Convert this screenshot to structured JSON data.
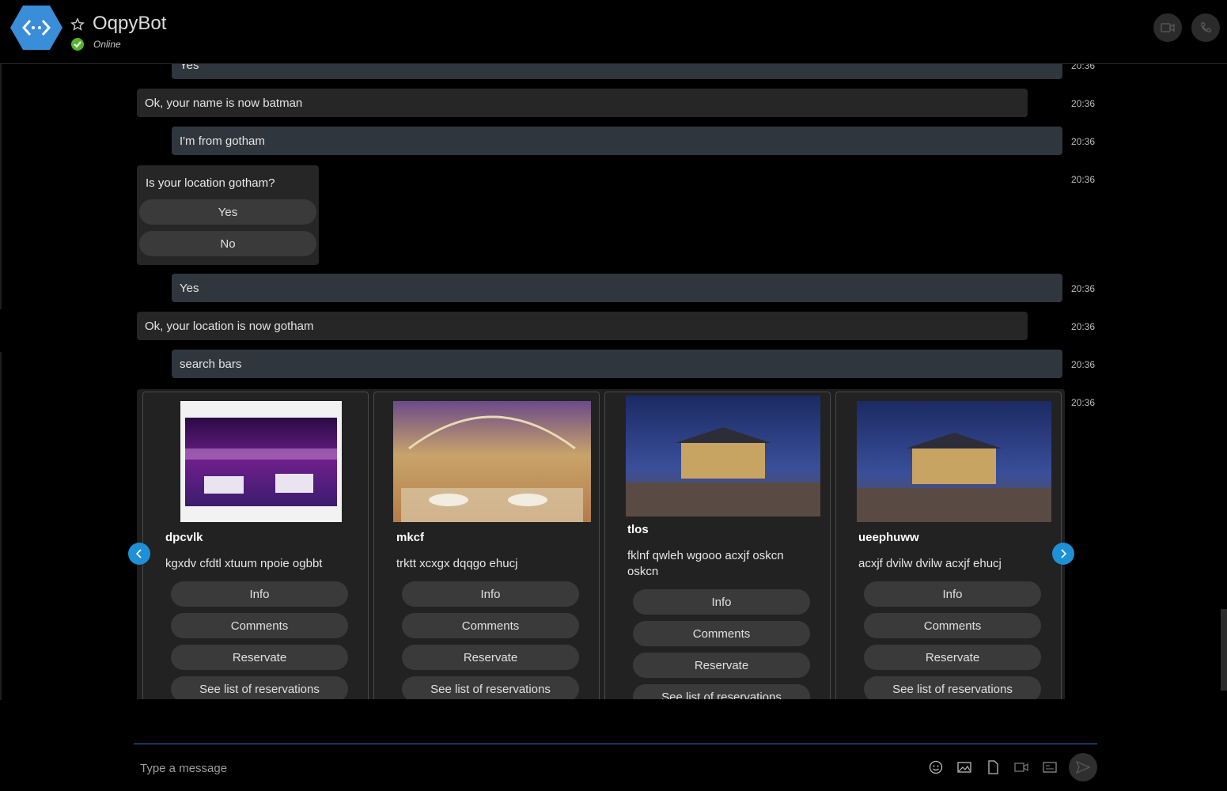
{
  "header": {
    "title": "OqpyBot",
    "status": "Online",
    "brand_color": "#3a8dd8",
    "status_color": "#58b32f"
  },
  "messages": [
    {
      "sender": "user",
      "text": "Yes",
      "time": "20:36"
    },
    {
      "sender": "bot",
      "text": "Ok, your name is now batman",
      "time": "20:36"
    },
    {
      "sender": "user",
      "text": "I'm from gotham",
      "time": "20:36"
    },
    {
      "sender": "bot",
      "type": "prompt",
      "text": "Is your location gotham?",
      "options": [
        "Yes",
        "No"
      ],
      "time": "20:36"
    },
    {
      "sender": "user",
      "text": "Yes",
      "time": "20:36"
    },
    {
      "sender": "bot",
      "text": "Ok, your location is now gotham",
      "time": "20:36"
    },
    {
      "sender": "user",
      "text": "search bars",
      "time": "20:36"
    }
  ],
  "carousel": {
    "time": "20:36",
    "cards": [
      {
        "title": "dpcvlk",
        "subtitle": "kgxdv cfdtl xtuum npoie ogbbt",
        "image": "rooftop-lounge-night-photo",
        "buttons": [
          "Info",
          "Comments",
          "Reservate",
          "See list of reservations"
        ]
      },
      {
        "title": "mkcf",
        "subtitle": "trktt xcxgx dqqgo ehucj",
        "image": "banquet-hall-photo",
        "buttons": [
          "Info",
          "Comments",
          "Reservate",
          "See list of reservations"
        ]
      },
      {
        "title": "tlos",
        "subtitle": "fklnf qwleh wgooo acxjf oskcn oskcn",
        "image": "mansion-night-photo",
        "buttons": [
          "Info",
          "Comments",
          "Reservate",
          "See list of reservations"
        ]
      },
      {
        "title": "ueephuww",
        "subtitle": "acxjf dvilw dvilw acxjf ehucj",
        "image": "mansion-night-photo",
        "buttons": [
          "Info",
          "Comments",
          "Reservate",
          "See list of reservations"
        ]
      }
    ]
  },
  "compose": {
    "placeholder": "Type a message",
    "icons": [
      "emoji-icon",
      "image-icon",
      "file-icon",
      "video-message-icon",
      "contact-card-icon",
      "send-icon"
    ]
  }
}
